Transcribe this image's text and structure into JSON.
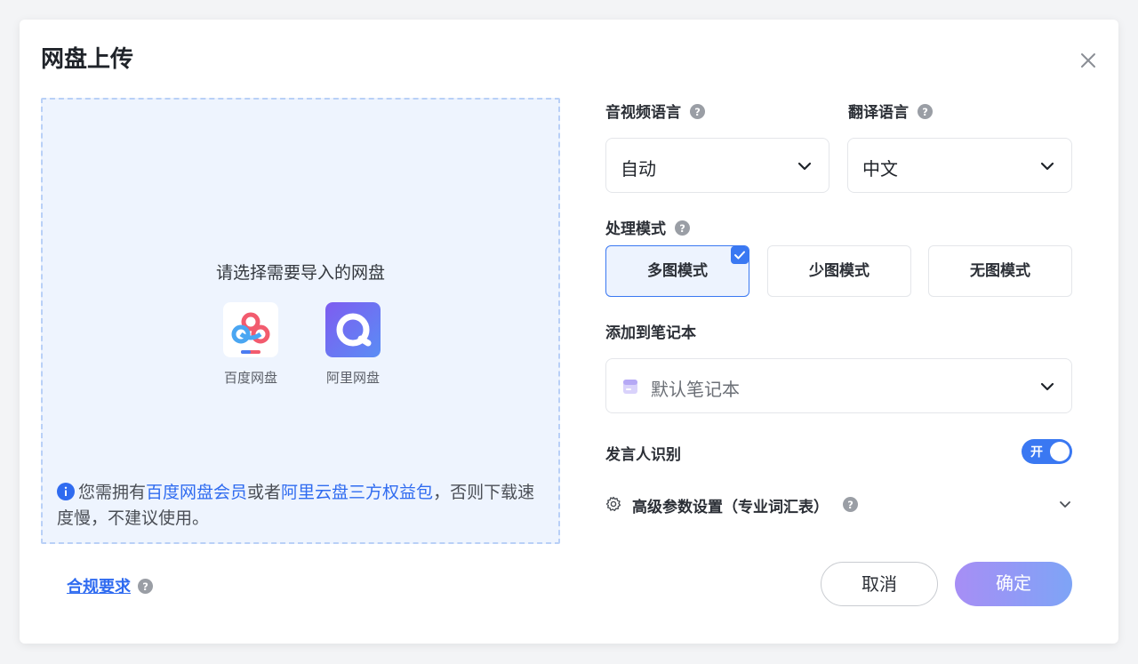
{
  "dialog": {
    "title": "网盘上传"
  },
  "upload": {
    "prompt": "请选择需要导入的网盘",
    "providers": [
      {
        "label": "百度网盘",
        "icon": "baidu-netdisk-icon"
      },
      {
        "label": "阿里网盘",
        "icon": "aliyun-drive-icon"
      }
    ],
    "notice": {
      "part1": "您需拥有",
      "link1": "百度网盘会员",
      "part2": "或者",
      "link2": "阿里云盘三方权益包",
      "part3": "，否则下载速度慢，不建议使用。"
    }
  },
  "compliance": {
    "link": "合规要求"
  },
  "form": {
    "audio_language": {
      "label": "音视频语言",
      "value": "自动"
    },
    "translate_language": {
      "label": "翻译语言",
      "value": "中文"
    },
    "mode": {
      "label": "处理模式",
      "options": [
        "多图模式",
        "少图模式",
        "无图模式"
      ],
      "selected": "多图模式"
    },
    "notebook": {
      "label": "添加到笔记本",
      "value": "默认笔记本"
    },
    "speaker": {
      "label": "发言人识别",
      "toggle_text": "开",
      "enabled": true
    },
    "advanced": {
      "label": "高级参数设置（专业词汇表）"
    }
  },
  "actions": {
    "cancel": "取消",
    "confirm": "确定"
  },
  "colors": {
    "accent": "#3a78f2",
    "link": "#2f6bf0",
    "drop_bg": "#eef4fe",
    "confirm_gradient_start": "#a78ef5",
    "confirm_gradient_end": "#7ea4f6"
  }
}
